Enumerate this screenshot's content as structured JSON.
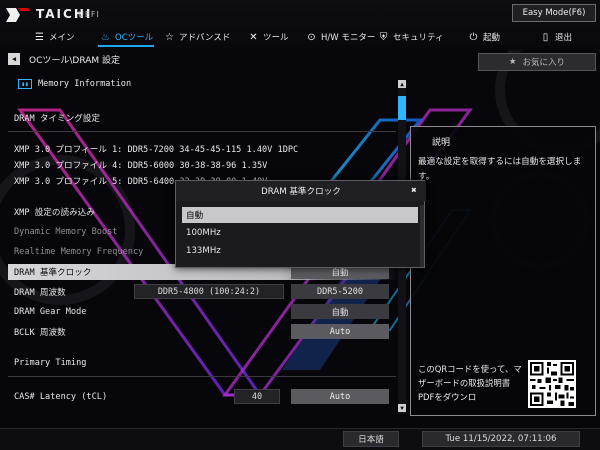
{
  "colors": {
    "accent": "#2fb6ff",
    "background": "#07070b",
    "panel_border": "#8a8a90"
  },
  "header": {
    "logo_text": "TAICHI",
    "logo_sub": "UEFI",
    "easy_mode_label": "Easy Mode(F6)",
    "tabs": [
      {
        "icon": "menu-icon",
        "label": "メイン"
      },
      {
        "icon": "oc-flame-icon",
        "label": "OCツール"
      },
      {
        "icon": "star-icon",
        "label": "アドバンスド"
      },
      {
        "icon": "tools-icon",
        "label": "ツール"
      },
      {
        "icon": "hw-monitor-icon",
        "label": "H/W モニター"
      },
      {
        "icon": "shield-icon",
        "label": "セキュリティ"
      },
      {
        "icon": "power-icon",
        "label": "起動"
      },
      {
        "icon": "exit-icon",
        "label": "退出"
      }
    ]
  },
  "breadcrumb": "OCツール\\DRAM 設定",
  "favorites_label": "お気に入り",
  "main": {
    "memory_info_label": "Memory Information",
    "timing_section_title": "DRAM タイミング設定",
    "xmp_profiles": [
      "XMP 3.0 プロフィール 1: DDR5-7200 34-45-45-115 1.40V 1DPC",
      "XMP 3.0 プロファイル 4: DDR5-6000 30-38-38-96 1.35V",
      "XMP 3.0 プロファイル 5: DDR5-6400 32-39-39-80 1.40V"
    ],
    "settings": [
      {
        "label": "XMP 設定の読み込み"
      },
      {
        "label": "Dynamic Memory Boost"
      },
      {
        "label": "Realtime Memory Frequency"
      },
      {
        "label": "DRAM 基準クロック",
        "value": "自動"
      },
      {
        "label": "DRAM 周波数",
        "current": "DDR5-4800 (100:24:2)",
        "value": "DDR5-5200"
      },
      {
        "label": "DRAM Gear Mode",
        "value": "自動"
      },
      {
        "label": "BCLK 周波数",
        "value": "Auto"
      }
    ],
    "primary_timing_title": "Primary Timing",
    "cas_latency": {
      "label": "CAS# Latency (tCL)",
      "current": "40",
      "value": "Auto"
    }
  },
  "description": {
    "title": "説明",
    "text": "最適な設定を取得するには自動を選択します。",
    "qr_text": "このQRコードを使って、マザーボードの取扱説明書PDFをダウンロ"
  },
  "popup": {
    "title": "DRAM 基準クロック",
    "options": [
      "自動",
      "100MHz",
      "133MHz"
    ],
    "selected_index": 0
  },
  "footer": {
    "language": "日本語",
    "datetime": "Tue 11/15/2022, 07:11:06"
  }
}
